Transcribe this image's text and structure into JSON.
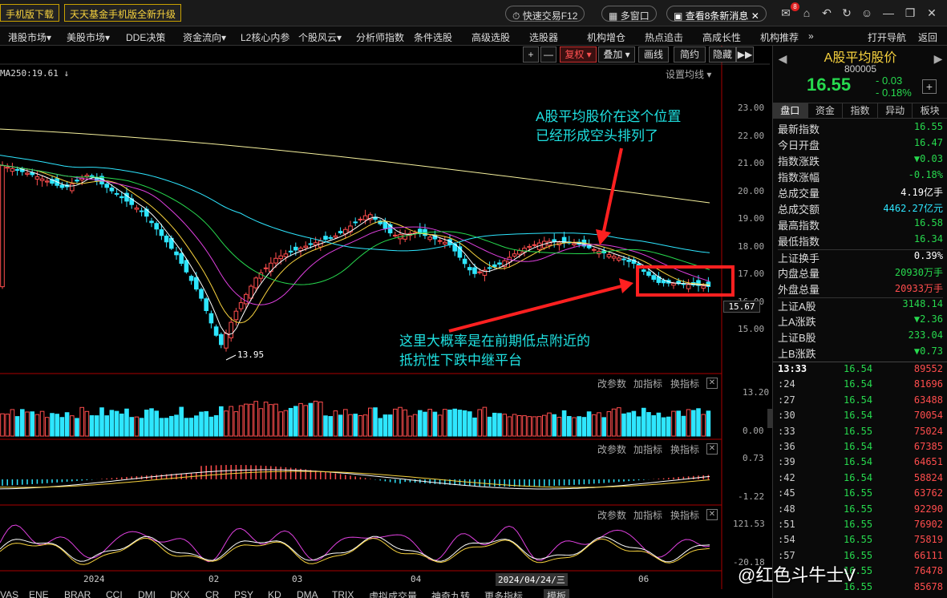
{
  "topbar": {
    "ad1": "手机版下载",
    "ad2": "天天基金手机版全新升级",
    "quick_trade": "快速交易F12",
    "multi_window": "多窗口",
    "new_messages": "查看8条新消息",
    "message_badge": "8"
  },
  "menu": [
    "港股市场▾",
    "美股市场▾",
    "DDE决策",
    "资金流向▾",
    "L2核心内参",
    "个股风云▾",
    "分析师指数",
    "条件选股",
    "高级选股",
    "选股器",
    "机构增仓",
    "热点追击",
    "高成长性",
    "机构推荐",
    "»",
    "打开导航",
    "返回"
  ],
  "toolbar": {
    "plus": "+",
    "minus": "—",
    "fuquan": "复权 ▾",
    "overlay": "叠加 ▾",
    "draw": "画线",
    "simple": "简约",
    "hide": "隐藏",
    "nav": "▶▶"
  },
  "chart": {
    "ma_label": "MA250:19.61 ↓",
    "set_ma": "设置均线 ▾",
    "price_axis": [
      "23.00",
      "22.00",
      "21.00",
      "20.00",
      "19.00",
      "18.00",
      "17.00",
      "16.00",
      "15.00"
    ],
    "current_price_tag": "15.67",
    "low_label": "13.95",
    "vol_axis": [
      "13.20",
      "0.00"
    ],
    "macd_axis": [
      "0.73",
      "-1.22"
    ],
    "kdj_axis": [
      "121.53",
      "-20.18"
    ],
    "indicator_buttons": [
      "改参数",
      "加指标",
      "换指标"
    ],
    "date_labels": [
      "2024",
      "02",
      "03",
      "04",
      "2024/04/24/三",
      "06"
    ],
    "annotation_top_1": "A股平均股价在这个位置",
    "annotation_top_2": "已经形成空头排列了",
    "annotation_bottom_1": "这里大概率是在前期低点附近的",
    "annotation_bottom_2": "抵抗性下跌中继平台"
  },
  "bottom_tabs": [
    "VAS",
    "ENE",
    "BRAR",
    "CCI",
    "DMI",
    "DKX",
    "CR",
    "PSY",
    "KD",
    "DMA",
    "TRIX",
    "虚拟成交量",
    "神奇九转",
    "更多指标",
    "模板"
  ],
  "quote": {
    "title": "A股平均股价",
    "code": "800005",
    "price": "16.55",
    "change": "- 0.03",
    "change_pct": "- 0.18%",
    "tabs": [
      "盘口",
      "资金",
      "指数",
      "异动",
      "板块"
    ],
    "stats": [
      {
        "k": "最新指数",
        "v": "16.55",
        "c": "#27d94e"
      },
      {
        "k": "今日开盘",
        "v": "16.47",
        "c": "#27d94e"
      },
      {
        "k": "指数涨跌",
        "v": "▼0.03",
        "c": "#27d94e"
      },
      {
        "k": "指数涨幅",
        "v": "-0.18%",
        "c": "#27d94e"
      },
      {
        "k": "总成交量",
        "v": "4.19亿手",
        "c": "#ffffff"
      },
      {
        "k": "总成交额",
        "v": "4462.27亿元",
        "c": "#2ee6ff"
      },
      {
        "k": "最高指数",
        "v": "16.58",
        "c": "#27d94e"
      },
      {
        "k": "最低指数",
        "v": "16.34",
        "c": "#27d94e"
      },
      {
        "k": "上证换手",
        "v": "0.39%",
        "c": "#ffffff"
      },
      {
        "k": "内盘总量",
        "v": "20930万手",
        "c": "#27d94e"
      },
      {
        "k": "外盘总量",
        "v": "20933万手",
        "c": "#ff4d4d"
      },
      {
        "k": "上证A股",
        "v": "3148.14",
        "c": "#27d94e"
      },
      {
        "k": "上A涨跌",
        "v": "▼2.36",
        "c": "#27d94e"
      },
      {
        "k": "上证B股",
        "v": "233.04",
        "c": "#27d94e"
      },
      {
        "k": "上B涨跌",
        "v": "▼0.73",
        "c": "#27d94e"
      }
    ],
    "ticks": [
      {
        "t": "13:33",
        "p": "16.54",
        "v": "89552"
      },
      {
        "t": ":24",
        "p": "16.54",
        "v": "81696"
      },
      {
        "t": ":27",
        "p": "16.54",
        "v": "63488"
      },
      {
        "t": ":30",
        "p": "16.54",
        "v": "70054"
      },
      {
        "t": ":33",
        "p": "16.55",
        "v": "75024"
      },
      {
        "t": ":36",
        "p": "16.54",
        "v": "67385"
      },
      {
        "t": ":39",
        "p": "16.54",
        "v": "64651"
      },
      {
        "t": ":42",
        "p": "16.54",
        "v": "58824"
      },
      {
        "t": ":45",
        "p": "16.55",
        "v": "63762"
      },
      {
        "t": ":48",
        "p": "16.55",
        "v": "92290"
      },
      {
        "t": ":51",
        "p": "16.55",
        "v": "76902"
      },
      {
        "t": ":54",
        "p": "16.55",
        "v": "75819"
      },
      {
        "t": ":57",
        "p": "16.55",
        "v": "66111"
      },
      {
        "t": "",
        "p": "16.55",
        "v": "76478"
      },
      {
        "t": "",
        "p": "16.55",
        "v": "85678"
      }
    ]
  },
  "watermark": "@红色斗牛士V",
  "colors": {
    "up": "#ff4d4d",
    "down": "#27d94e",
    "down_bar": "#2ee6ff",
    "highlight_box": "#ff2020",
    "annotation": "#1fe0e0"
  }
}
